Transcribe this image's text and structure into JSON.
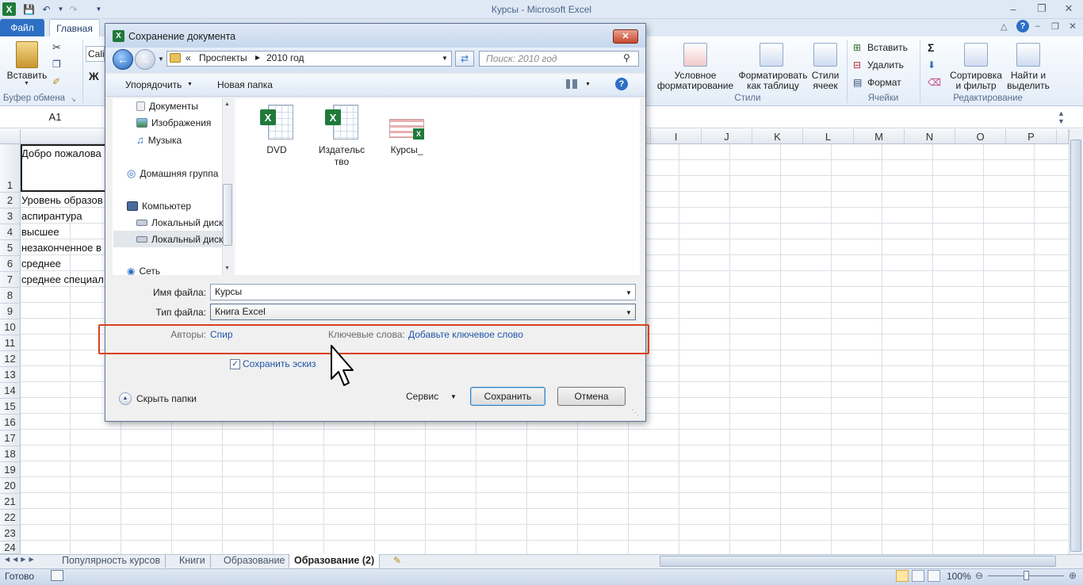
{
  "window": {
    "title": "Курсы - Microsoft Excel"
  },
  "ribbon": {
    "tabs": {
      "file": "Файл",
      "home": "Главная"
    },
    "paste": "Вставить",
    "clipboard_group": "Буфер обмена",
    "font_name": "Cali",
    "bold": "Ж",
    "cond_format": [
      "Условное",
      "форматирование"
    ],
    "format_table": [
      "Форматировать",
      "как таблицу"
    ],
    "cell_styles": [
      "Стили",
      "ячеек"
    ],
    "styles_group": "Стили",
    "insert": "Вставить",
    "delete": "Удалить",
    "format": "Формат",
    "cells_group": "Ячейки",
    "sort_filter": [
      "Сортировка",
      "и фильтр"
    ],
    "find_select": [
      "Найти и",
      "выделить"
    ],
    "editing_group": "Редактирование",
    "sigma": "Σ"
  },
  "namebox": "A1",
  "columns": [
    "I",
    "J",
    "K",
    "L",
    "M",
    "N",
    "O",
    "P"
  ],
  "rows": [
    "1",
    "2",
    "3",
    "4",
    "5",
    "6",
    "7",
    "8",
    "9",
    "10",
    "11",
    "12",
    "13",
    "14",
    "15",
    "16",
    "17",
    "18",
    "19",
    "20",
    "21",
    "22",
    "23",
    "24"
  ],
  "cells": [
    "Добро пожалова",
    "Уровень образов",
    "аспирантура",
    "высшее",
    "незаконченное в",
    "среднее",
    "среднее специал"
  ],
  "sheets": [
    "Популярность курсов",
    "Книги",
    "Образование",
    "Образование (2)"
  ],
  "status": {
    "ready": "Готово",
    "zoom": "100%"
  },
  "dialog": {
    "title": "Сохранение документа",
    "breadcrumb": {
      "prefix": "«",
      "folder": "Проспекты",
      "subfolder": "2010 год"
    },
    "search_placeholder": "Поиск: 2010 год",
    "organize": "Упорядочить",
    "new_folder": "Новая папка",
    "nav": [
      "Документы",
      "Изображения",
      "Музыка",
      "Домашняя группа",
      "Компьютер",
      "Локальный диск",
      "Локальный диск",
      "Сеть"
    ],
    "files": [
      {
        "name": "DVD"
      },
      {
        "name": "Издательство"
      },
      {
        "name": "Курсы_"
      }
    ],
    "filename_label": "Имя файла:",
    "filename": "Курсы",
    "filetype_label": "Тип файла:",
    "filetype": "Книга Excel",
    "authors_label": "Авторы:",
    "authors": "Спир",
    "keywords_label": "Ключевые слова:",
    "keywords": "Добавьте ключевое слово",
    "save_thumbnail": "Сохранить эскиз",
    "hide_folders": "Скрыть папки",
    "service": "Сервис",
    "save": "Сохранить",
    "cancel": "Отмена"
  },
  "highlight_color": "#d9401f"
}
